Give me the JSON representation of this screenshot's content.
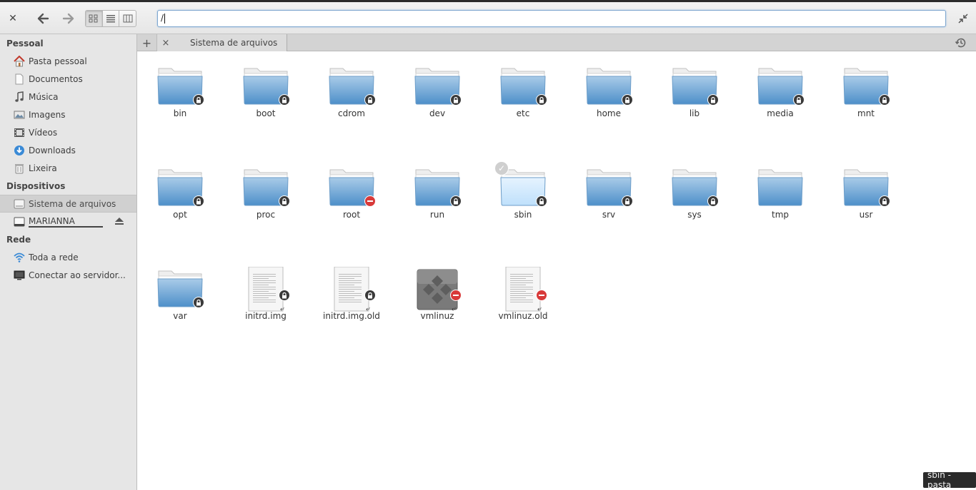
{
  "toolbar": {
    "close_icon": "close-icon",
    "back_icon": "back-arrow-icon",
    "forward_icon": "forward-arrow-icon",
    "view_modes": [
      "icon-view",
      "list-view",
      "column-view"
    ],
    "location_value": "/",
    "restore_icon": "restore-window-icon"
  },
  "sidebar": {
    "sections": [
      {
        "heading": "Pessoal",
        "items": [
          {
            "label": "Pasta pessoal",
            "icon": "home-icon"
          },
          {
            "label": "Documentos",
            "icon": "document-icon"
          },
          {
            "label": "Música",
            "icon": "music-icon"
          },
          {
            "label": "Imagens",
            "icon": "image-icon"
          },
          {
            "label": "Vídeos",
            "icon": "video-icon"
          },
          {
            "label": "Downloads",
            "icon": "download-icon"
          },
          {
            "label": "Lixeira",
            "icon": "trash-icon"
          }
        ]
      },
      {
        "heading": "Dispositivos",
        "items": [
          {
            "label": "Sistema de arquivos",
            "icon": "filesystem-icon",
            "selected": true
          },
          {
            "label": "MARIANNA",
            "icon": "drive-icon"
          }
        ]
      },
      {
        "heading": "Rede",
        "items": [
          {
            "label": "Toda a rede",
            "icon": "network-icon"
          },
          {
            "label": "Conectar ao servidor...",
            "icon": "monitor-icon"
          }
        ]
      }
    ]
  },
  "tabs": {
    "add_label": "+",
    "active_tab": {
      "label": "Sistema de arquivos",
      "close": "×"
    }
  },
  "files": [
    {
      "name": "bin",
      "type": "folder",
      "emblem": "lock"
    },
    {
      "name": "boot",
      "type": "folder",
      "emblem": "lock"
    },
    {
      "name": "cdrom",
      "type": "folder",
      "emblem": "lock"
    },
    {
      "name": "dev",
      "type": "folder",
      "emblem": "lock"
    },
    {
      "name": "etc",
      "type": "folder",
      "emblem": "lock"
    },
    {
      "name": "home",
      "type": "folder",
      "emblem": "lock"
    },
    {
      "name": "lib",
      "type": "folder",
      "emblem": "lock"
    },
    {
      "name": "media",
      "type": "folder",
      "emblem": "lock"
    },
    {
      "name": "mnt",
      "type": "folder",
      "emblem": "lock"
    },
    {
      "name": "opt",
      "type": "folder",
      "emblem": "lock"
    },
    {
      "name": "proc",
      "type": "folder",
      "emblem": "lock"
    },
    {
      "name": "root",
      "type": "folder",
      "emblem": "noentry"
    },
    {
      "name": "run",
      "type": "folder",
      "emblem": "lock"
    },
    {
      "name": "sbin",
      "type": "folder",
      "emblem": "lock",
      "hovered": true
    },
    {
      "name": "srv",
      "type": "folder",
      "emblem": "lock"
    },
    {
      "name": "sys",
      "type": "folder",
      "emblem": "lock"
    },
    {
      "name": "tmp",
      "type": "folder",
      "emblem": "none"
    },
    {
      "name": "usr",
      "type": "folder",
      "emblem": "lock"
    },
    {
      "name": "var",
      "type": "folder",
      "emblem": "lock"
    },
    {
      "name": "initrd.img",
      "type": "doc-link",
      "emblem": "lock"
    },
    {
      "name": "initrd.img.old",
      "type": "doc-link",
      "emblem": "lock"
    },
    {
      "name": "vmlinuz",
      "type": "exe-link",
      "emblem": "noentry"
    },
    {
      "name": "vmlinuz.old",
      "type": "doc-link",
      "emblem": "noentry"
    }
  ],
  "tooltip": "sbin - pasta",
  "colors": {
    "folder_top": "#a9cbe8",
    "folder_bottom": "#4d8fc9",
    "accent": "#7fa7cf"
  }
}
